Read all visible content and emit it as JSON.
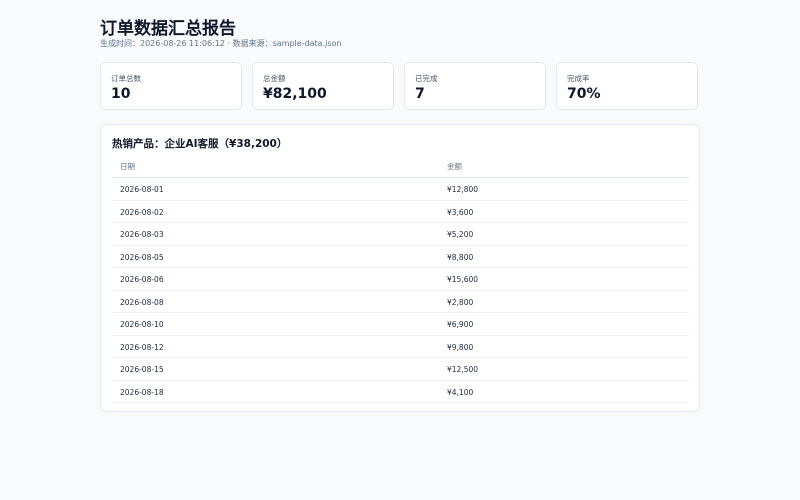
{
  "header": {
    "title": "订单数据汇总报告",
    "subtitle": "生成时间：2026-08-26 11:06:12 · 数据来源：sample-data.json"
  },
  "stats": [
    {
      "label": "订单总数",
      "value": "10"
    },
    {
      "label": "总金额",
      "value": "¥82,100"
    },
    {
      "label": "已完成",
      "value": "7"
    },
    {
      "label": "完成率",
      "value": "70%"
    }
  ],
  "panel": {
    "title": "热销产品：企业AI客服（¥38,200）",
    "columns": [
      "日期",
      "金额"
    ],
    "rows": [
      {
        "date": "2026-08-01",
        "amount": "¥12,800"
      },
      {
        "date": "2026-08-02",
        "amount": "¥3,600"
      },
      {
        "date": "2026-08-03",
        "amount": "¥5,200"
      },
      {
        "date": "2026-08-05",
        "amount": "¥8,800"
      },
      {
        "date": "2026-08-06",
        "amount": "¥15,600"
      },
      {
        "date": "2026-08-08",
        "amount": "¥2,800"
      },
      {
        "date": "2026-08-10",
        "amount": "¥6,900"
      },
      {
        "date": "2026-08-12",
        "amount": "¥9,800"
      },
      {
        "date": "2026-08-15",
        "amount": "¥12,500"
      },
      {
        "date": "2026-08-18",
        "amount": "¥4,100"
      }
    ]
  }
}
